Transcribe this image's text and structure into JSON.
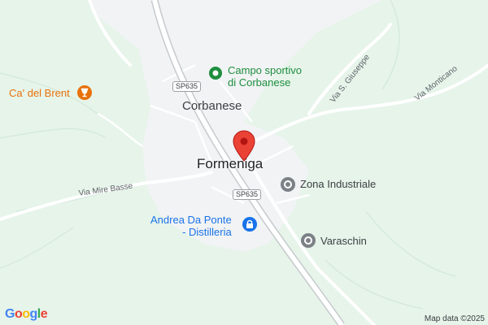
{
  "map": {
    "places": {
      "corbanese": "Corbanese",
      "formeniga": "Formeniga"
    },
    "roads": {
      "sp635_top": "SP635",
      "sp635_bottom": "SP635",
      "via_mire_basse": "Via Mire Basse",
      "via_s_giuseppe": "Via S. Giuseppe",
      "via_monticano": "Via Monticano"
    },
    "pois": {
      "campo_sportivo_line1": "Campo sportivo",
      "campo_sportivo_line2": "di Corbanese",
      "ca_del_brent": "Ca' del Brent",
      "zona_industriale": "Zona Industriale",
      "andrea_line1": "Andrea Da Ponte",
      "andrea_line2": "- Distilleria",
      "varaschin": "Varaschin"
    },
    "icons": {
      "campo": "park-icon",
      "brent": "wine-bar-icon",
      "zona": "place-icon",
      "andrea": "shopping-icon",
      "varaschin": "place-icon",
      "pin": "location-pin-icon"
    },
    "colors": {
      "land": "#e8f5ec",
      "urban": "#f1f3f4",
      "road": "#ffffff",
      "pin": "#ea4335",
      "park": "#1e8e3e",
      "blue": "#1a73e8",
      "orange": "#e8710a"
    },
    "attribution": "Map data ©2025",
    "logo": "Google"
  }
}
